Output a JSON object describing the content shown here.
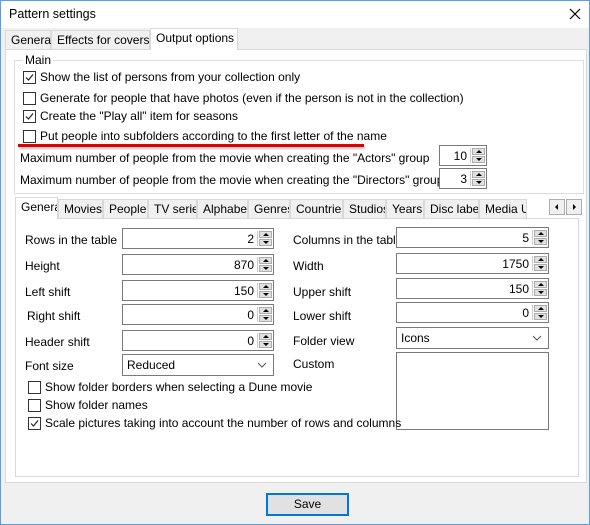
{
  "window": {
    "title": "Pattern settings",
    "close_icon": "close-icon"
  },
  "top_tabs": [
    {
      "label": "General",
      "active": false
    },
    {
      "label": "Effects for covers",
      "active": false
    },
    {
      "label": "Output options",
      "active": true
    }
  ],
  "main_group": {
    "label": "Main",
    "checkboxes": [
      {
        "label": "Show the list of persons from your collection only",
        "checked": true
      },
      {
        "label": "Generate for people that have photos (even if the person is not in the collection)",
        "checked": false
      },
      {
        "label": "Create the \"Play all\" item for seasons",
        "checked": true
      },
      {
        "label": "Put people into subfolders according to the first letter of the name",
        "checked": false
      }
    ],
    "max_actors": {
      "label": "Maximum number of people from the movie when creating the \"Actors\" group",
      "value": "10"
    },
    "max_directors": {
      "label": "Maximum number of people from the movie when creating the \"Directors\" group",
      "value": "3"
    }
  },
  "inner_tabs": [
    {
      "label": "General",
      "active": true
    },
    {
      "label": "Movies",
      "active": false
    },
    {
      "label": "People",
      "active": false
    },
    {
      "label": "TV series",
      "active": false
    },
    {
      "label": "Alphabet",
      "active": false
    },
    {
      "label": "Genres",
      "active": false
    },
    {
      "label": "Countries",
      "active": false
    },
    {
      "label": "Studios",
      "active": false
    },
    {
      "label": "Years",
      "active": false
    },
    {
      "label": "Disc label",
      "active": false
    },
    {
      "label": "Media U",
      "active": false
    }
  ],
  "general": {
    "left": [
      {
        "label": "Rows in the table",
        "value": "2"
      },
      {
        "label": "Height",
        "value": "870"
      },
      {
        "label": "Left shift",
        "value": "150"
      },
      {
        "label": "Right shift",
        "value": "0"
      },
      {
        "label": "Header shift",
        "value": "0"
      }
    ],
    "font_size": {
      "label": "Font size",
      "value": "Reduced"
    },
    "right": [
      {
        "label": "Columns in the table",
        "value": "5"
      },
      {
        "label": "Width",
        "value": "1750"
      },
      {
        "label": "Upper shift",
        "value": "150"
      },
      {
        "label": "Lower shift",
        "value": "0"
      }
    ],
    "folder_view": {
      "label": "Folder view",
      "value": "Icons"
    },
    "custom": {
      "label": "Custom",
      "value": ""
    },
    "checkboxes": [
      {
        "label": "Show folder borders when selecting a Dune movie",
        "checked": false
      },
      {
        "label": "Show folder names",
        "checked": false
      },
      {
        "label": "Scale pictures taking into account the number of rows and columns",
        "checked": true
      }
    ]
  },
  "footer": {
    "save_label": "Save"
  },
  "colors": {
    "accent": "#0078d7",
    "highlight_line": "#e00000"
  }
}
